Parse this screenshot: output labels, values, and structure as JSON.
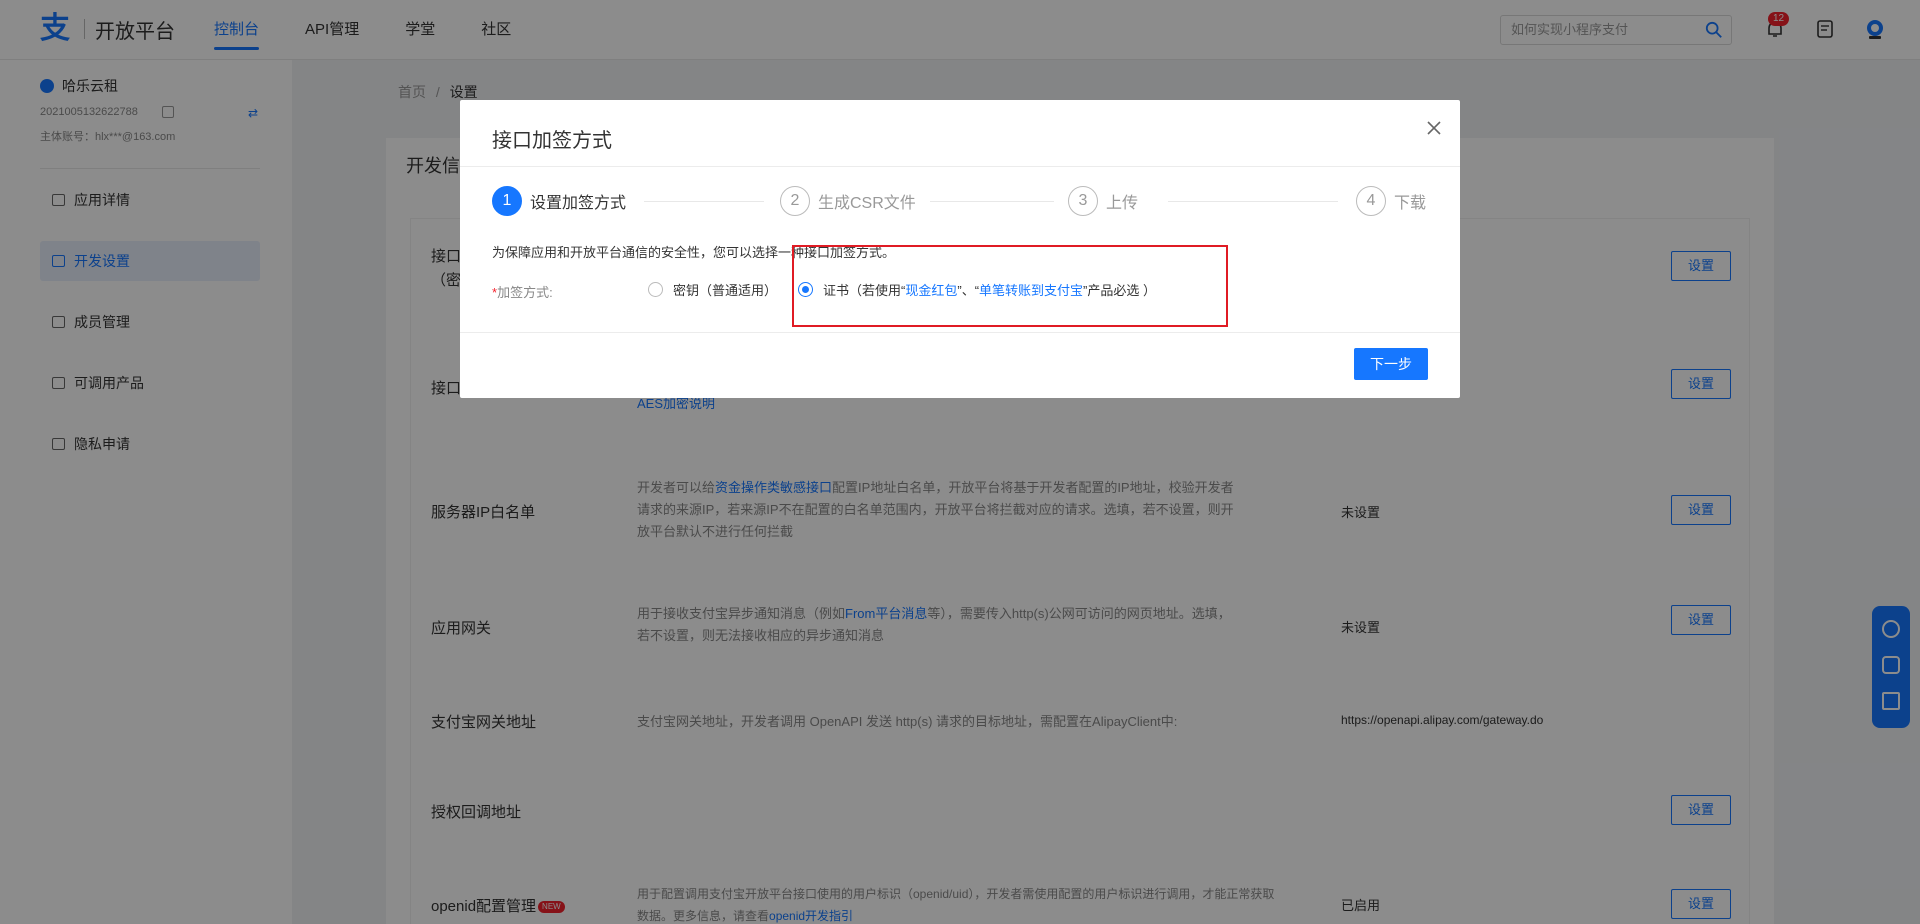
{
  "header": {
    "logo_mark": "支",
    "logo_text": "开放平台",
    "nav": [
      "控制台",
      "API管理",
      "学堂",
      "社区"
    ],
    "search_placeholder": "如何实现小程序支付",
    "notification_count": "12"
  },
  "sidebar": {
    "app_name": "哈乐云租",
    "app_id": "2021005132622788",
    "owner": "主体账号：hlx***@163.com",
    "swap": "⇄",
    "items": [
      "应用详情",
      "开发设置",
      "成员管理",
      "可调用产品",
      "隐私申请"
    ]
  },
  "breadcrumb": {
    "home": "首页",
    "sep": "/",
    "current": "设置"
  },
  "main": {
    "title": "开发信息",
    "rows": [
      {
        "label": "接口加签方式（密钥/证书）",
        "label_l1": "接口",
        "label_l2": "（密",
        "button": "设置"
      },
      {
        "label": "接口",
        "desc_link": "AES加密说明",
        "button": "设置"
      },
      {
        "label": "服务器IP白名单",
        "desc_pre": "开发者可以给",
        "desc_link": "资金操作类敏感接口",
        "desc_post": "配置IP地址白名单，开放平台将基于开发者配置的IP地址，校验开发者",
        "desc_l2": "请求的来源IP，若来源IP不在配置的白名单范围内，开放平台将拦截对应的请求。选填，若不设置，则开",
        "desc_l3": "放平台默认不进行任何拦截",
        "value": "未设置",
        "button": "设置"
      },
      {
        "label": "应用网关",
        "desc_pre": "用于接收支付宝异步通知消息（例如",
        "desc_link": "From平台消息",
        "desc_post": "等），需要传入http(s)公网可访问的网页地址。选填，",
        "desc_l2": "若不设置，则无法接收相应的异步通知消息",
        "value": "未设置",
        "button": "设置"
      },
      {
        "label": "支付宝网关地址",
        "desc": "支付宝网关地址，开发者调用 OpenAPI 发送 http(s) 请求的目标地址，需配置在AlipayClient中:",
        "value": "https://openapi.alipay.com/gateway.do"
      },
      {
        "label": "授权回调地址",
        "button": "设置"
      },
      {
        "label": "openid配置管理",
        "badge": "NEW",
        "desc": "用于配置调用支付宝开放平台接口使用的用户标识（openid/uid），开发者需使用配置的用户标识进行调用，才能正常获取",
        "desc_l2_pre": "数据。更多信息，请查看",
        "desc_l2_link": "openid开发指引",
        "value": "已启用",
        "button": "设置"
      }
    ]
  },
  "modal": {
    "title": "接口加签方式",
    "steps": [
      {
        "num": "1",
        "label": "设置加签方式"
      },
      {
        "num": "2",
        "label": "生成CSR文件"
      },
      {
        "num": "3",
        "label": "上传"
      },
      {
        "num": "4",
        "label": "下载"
      }
    ],
    "intro": "为保障应用和开放平台通信的安全性，您可以选择一种接口加签方式。",
    "field_required": "*",
    "field_label": "加签方式:",
    "option_key": "密钥（普通适用）",
    "option_cert_pre": "证书（若使用“",
    "option_cert_link1": "现金红包",
    "option_cert_mid": "”、“",
    "option_cert_link2": "单笔转账到支付宝",
    "option_cert_post": "”产品必选 ）",
    "next_button": "下一步"
  },
  "colors": {
    "accent": "#1677ff",
    "highlight": "#e01b24"
  }
}
